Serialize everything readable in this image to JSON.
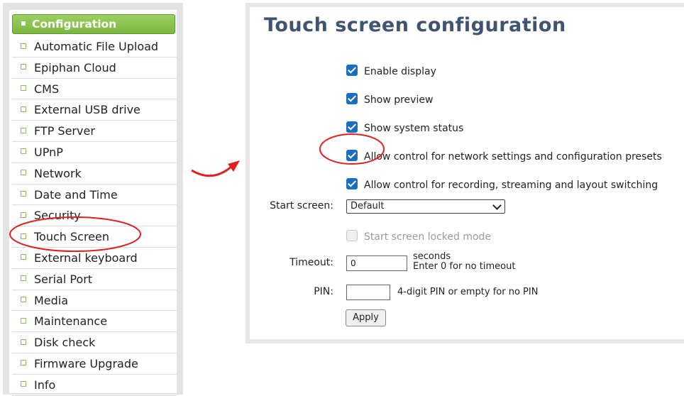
{
  "sidebar": {
    "header": "Configuration",
    "items": [
      {
        "label": "Automatic File Upload"
      },
      {
        "label": "Epiphan Cloud"
      },
      {
        "label": "CMS"
      },
      {
        "label": "External USB drive"
      },
      {
        "label": "FTP Server"
      },
      {
        "label": "UPnP"
      },
      {
        "label": "Network"
      },
      {
        "label": "Date and Time"
      },
      {
        "label": "Security"
      },
      {
        "label": "Touch Screen"
      },
      {
        "label": "External keyboard"
      },
      {
        "label": "Serial Port"
      },
      {
        "label": "Media"
      },
      {
        "label": "Maintenance"
      },
      {
        "label": "Disk check"
      },
      {
        "label": "Firmware Upgrade"
      },
      {
        "label": "Info"
      }
    ]
  },
  "panel": {
    "title": "Touch screen configuration",
    "checkboxes": [
      {
        "label": "Enable display",
        "checked": true
      },
      {
        "label": "Show preview",
        "checked": true
      },
      {
        "label": "Show system status",
        "checked": true
      },
      {
        "label": "Allow control for network settings and configuration presets",
        "checked": true
      },
      {
        "label": "Allow control for recording, streaming and layout switching",
        "checked": true
      }
    ],
    "start_screen": {
      "label": "Start screen:",
      "value": "Default"
    },
    "locked_mode": {
      "label": "Start screen locked mode",
      "checked": false,
      "disabled": true
    },
    "timeout": {
      "label": "Timeout:",
      "value": "0",
      "unit": "seconds",
      "hint": "Enter 0 for no timeout"
    },
    "pin": {
      "label": "PIN:",
      "value": "",
      "hint": "4-digit PIN or empty for no PIN"
    },
    "apply_label": "Apply"
  },
  "colors": {
    "accent_green": "#7cb73f",
    "title_blue": "#3e5470",
    "checkbox_blue": "#1a6fc4",
    "annotation_red": "#e02020"
  }
}
